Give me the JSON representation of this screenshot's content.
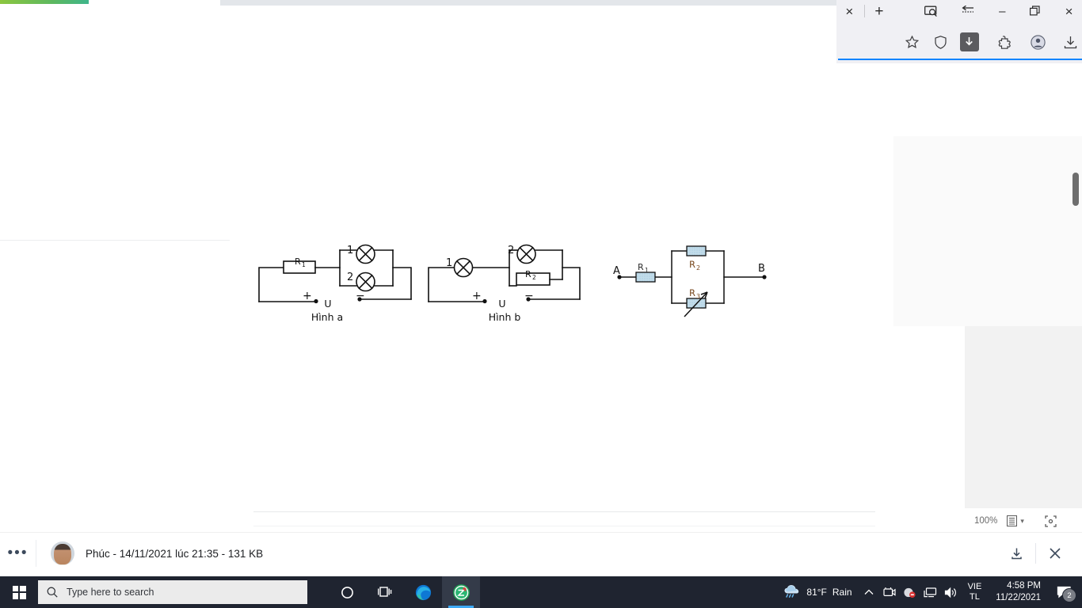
{
  "window": {
    "browser_tab_controls": {
      "close_tab_label": "×",
      "new_tab_label": "+",
      "tab_search_icon": "tab-search-icon",
      "history_back_icon": "history-recent-icon",
      "minimize_label": "–",
      "restore_label": "❐",
      "close_window_label": "×"
    },
    "toolbar_icons": [
      {
        "name": "bookmark-star-icon",
        "label": "Bookmark this page"
      },
      {
        "name": "shield-icon",
        "label": "Tracking protection"
      },
      {
        "name": "downloads-arrow-icon",
        "label": "Downloads",
        "highlighted": true
      },
      {
        "name": "extensions-puzzle-icon",
        "label": "Extensions"
      },
      {
        "name": "account-avatar-icon",
        "label": "Account"
      },
      {
        "name": "save-download-icon",
        "label": "Save to device"
      }
    ],
    "accent_color": "#0a84ff"
  },
  "pdf_viewer": {
    "zoom_level": "100%",
    "page_view_icon": "page-layout-icon",
    "page_view_caret": "▾",
    "fit_screen_icon": "fit-to-screen-icon"
  },
  "photo_viewer": {
    "more_options_label": "•••",
    "sender": "Phúc",
    "caption": "Phúc - 14/11/2021 lúc 21:35 - 131 KB",
    "download_icon": "download-icon",
    "close_icon": "close-icon"
  },
  "taskbar": {
    "start_icon": "windows-start-icon",
    "search_placeholder": "Type here to search",
    "search_icon": "search-icon",
    "apps": [
      {
        "name": "cortana-circle-icon",
        "label": "Cortana",
        "active": false
      },
      {
        "name": "task-view-icon",
        "label": "Task View",
        "active": false
      },
      {
        "name": "microsoft-edge-icon",
        "label": "Microsoft Edge",
        "active": false
      },
      {
        "name": "zalo-icon",
        "label": "Zalo",
        "active": true
      }
    ],
    "tray": {
      "weather_icon": "rain-cloud-icon",
      "weather_temp": "81°F",
      "weather_condition": "Rain",
      "show_hidden_icons": "chevron-up-icon",
      "camera_icon": "camera-icon",
      "unikey_icon": "unikey-icon",
      "network_icon": "network-monitor-icon",
      "volume_icon": "volume-icon",
      "language_line1": "VIE",
      "language_line2": "TL",
      "time": "4:58 PM",
      "date": "11/22/2021",
      "notification_icon": "notification-icon",
      "notification_count": "2"
    }
  },
  "document": {
    "figures": [
      {
        "id": "hinh-a",
        "caption": "Hình a",
        "components": [
          {
            "name": "resistor-r1",
            "label": "R₁",
            "type": "resistor"
          },
          {
            "name": "lamp-1",
            "label": "1",
            "type": "lamp"
          },
          {
            "name": "lamp-2",
            "label": "2",
            "type": "lamp"
          }
        ],
        "source_label": "U",
        "polarity_positive": "+",
        "polarity_negative": "−"
      },
      {
        "id": "hinh-b",
        "caption": "Hình b",
        "components": [
          {
            "name": "lamp-1",
            "label": "1",
            "type": "lamp"
          },
          {
            "name": "lamp-2",
            "label": "2",
            "type": "lamp"
          },
          {
            "name": "resistor-r2",
            "label": "R₂",
            "type": "resistor"
          }
        ],
        "source_label": "U",
        "polarity_positive": "+",
        "polarity_negative": "−"
      },
      {
        "id": "series-parallel-network",
        "caption": "",
        "terminal_left": "A",
        "terminal_right": "B",
        "components": [
          {
            "name": "resistor-r1",
            "label": "R₁",
            "type": "resistor"
          },
          {
            "name": "resistor-r2",
            "label": "R₂",
            "type": "resistor"
          },
          {
            "name": "resistor-r3",
            "label": "R₃",
            "type": "variable-resistor"
          }
        ],
        "resistor_fill": "#bcd9e8",
        "label_color": "#7a4a20"
      }
    ]
  }
}
